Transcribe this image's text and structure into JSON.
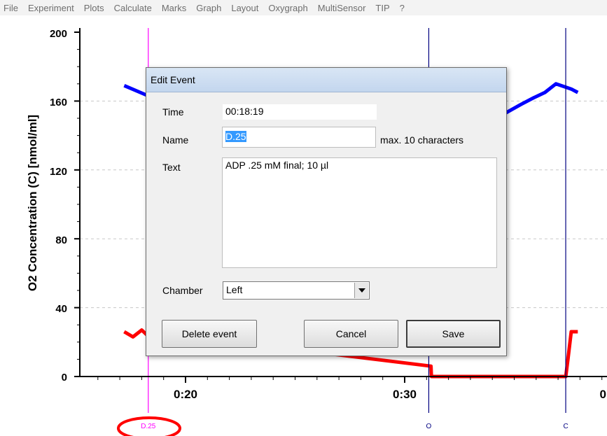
{
  "menu": [
    "File",
    "Experiment",
    "Plots",
    "Calculate",
    "Marks",
    "Graph",
    "Layout",
    "Oxygraph",
    "MultiSensor",
    "TIP",
    "?"
  ],
  "chart_data": {
    "type": "line",
    "ylabel": "O2 Concentration (C) [nmol/ml]",
    "yticks": [
      "200",
      "160",
      "120",
      "80",
      "40",
      "0"
    ],
    "xticks": [
      "0:20",
      "0:30",
      "0"
    ],
    "ylim": [
      0,
      200
    ],
    "grid": "horizontal dashed",
    "series": [
      {
        "color": "#0000ff",
        "x": [
          17.2,
          18.3,
          19.0,
          31.1,
          32.0,
          33.0,
          33.9,
          34.6,
          35.3,
          35.9,
          36.4,
          36.9,
          37.6,
          37.9
        ],
        "values": [
          169,
          163,
          157,
          134,
          139,
          144,
          149,
          153,
          158,
          162,
          165,
          170,
          167,
          165
        ]
      },
      {
        "color": "#ff0000",
        "x": [
          17.2,
          17.6,
          18.0,
          18.5,
          18.8,
          19.0,
          31.2,
          31.22,
          37.35,
          37.45,
          37.6,
          37.8,
          37.9
        ],
        "values": [
          26,
          23,
          27,
          21,
          27,
          25,
          6,
          0,
          0,
          10,
          26,
          26,
          26
        ]
      }
    ],
    "events": [
      {
        "name": "D.25",
        "time_minutes": 18.3,
        "color": "#ff00ff"
      },
      {
        "name": "O",
        "time_minutes": 31.1,
        "color": "#000080"
      },
      {
        "name": "C",
        "time_minutes": 37.35,
        "color": "#000080"
      }
    ]
  },
  "dialog": {
    "title": "Edit Event",
    "time_label": "Time",
    "time_value": "00:18:19",
    "name_label": "Name",
    "name_value": "D.25",
    "name_hint": "max. 10 characters",
    "text_label": "Text",
    "text_value": "ADP .25 mM final; 10 µl",
    "chamber_label": "Chamber",
    "chamber_value": "Left",
    "delete_label": "Delete event",
    "cancel_label": "Cancel",
    "save_label": "Save"
  }
}
